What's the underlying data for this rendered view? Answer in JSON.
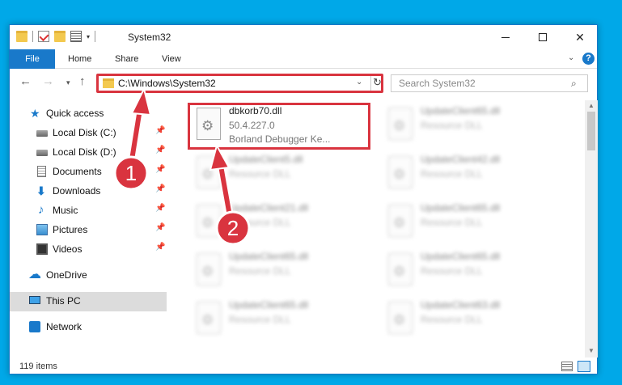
{
  "window": {
    "title": "System32"
  },
  "ribbon": {
    "tabs": [
      "File",
      "Home",
      "Share",
      "View"
    ],
    "help": "?"
  },
  "nav": {
    "address": "C:\\Windows\\System32",
    "search_placeholder": "Search System32"
  },
  "sidebar": {
    "items": [
      {
        "label": "Quick access",
        "icon": "star-icon"
      },
      {
        "label": "Local Disk (C:)",
        "icon": "disk-icon",
        "pinned": true
      },
      {
        "label": "Local Disk (D:)",
        "icon": "disk-icon",
        "pinned": true
      },
      {
        "label": "Documents",
        "icon": "documents-icon",
        "pinned": true
      },
      {
        "label": "Downloads",
        "icon": "download-icon",
        "pinned": true
      },
      {
        "label": "Music",
        "icon": "music-icon",
        "pinned": true
      },
      {
        "label": "Pictures",
        "icon": "pictures-icon",
        "pinned": true
      },
      {
        "label": "Videos",
        "icon": "videos-icon",
        "pinned": true
      },
      {
        "label": "OneDrive",
        "icon": "cloud-icon"
      },
      {
        "label": "This PC",
        "icon": "pc-icon",
        "selected": true
      },
      {
        "label": "Network",
        "icon": "network-icon"
      }
    ]
  },
  "files": {
    "highlighted": {
      "name": "dbkorb70.dll",
      "version": "50.4.227.0",
      "description": "Borland Debugger Ke..."
    },
    "left_column": [
      {
        "name": "UpdateClient5.dll",
        "type": "Resource DLL"
      },
      {
        "name": "UpdateClient21.dll",
        "type": "Resource DLL"
      },
      {
        "name": "UpdateClient65.dll",
        "type": "Resource DLL"
      },
      {
        "name": "UpdateClient65.dll",
        "type": "Resource DLL"
      }
    ],
    "right_column": [
      {
        "name": "UpdateClient65.dll",
        "type": "Resource DLL"
      },
      {
        "name": "UpdateClient42.dll",
        "type": "Resource DLL"
      },
      {
        "name": "UpdateClient65.dll",
        "type": "Resource DLL"
      },
      {
        "name": "UpdateClient65.dll",
        "type": "Resource DLL"
      },
      {
        "name": "UpdateClient63.dll",
        "type": "Resource DLL"
      }
    ]
  },
  "status": {
    "item_count": "119 items"
  },
  "annotations": {
    "step1": "1",
    "step2": "2"
  },
  "colors": {
    "accent": "#1979ca",
    "highlight": "#d9343f",
    "background": "#00a8e8"
  }
}
